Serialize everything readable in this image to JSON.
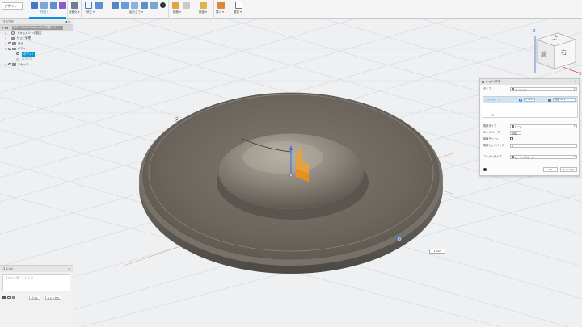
{
  "toolbar": {
    "workspace": "デザイン ▾",
    "groups": [
      {
        "label": "作成 ▾",
        "active": true
      },
      {
        "label": "自動化 ▾"
      },
      {
        "label": "修正 ▾"
      },
      {
        "label": "組み立て ▾"
      },
      {
        "label": "構築 ▾"
      },
      {
        "label": "検査 ▾"
      },
      {
        "label": "挿入 ▾"
      },
      {
        "label": "選択 ▾"
      }
    ]
  },
  "browser": {
    "title": "ブラウザ",
    "items": [
      {
        "label": "SMP・Model Preparation(作業) v1",
        "root": true
      },
      {
        "label": "ドキュメントの設定"
      },
      {
        "label": "ビュー管理"
      },
      {
        "label": "原点"
      },
      {
        "label": "ボディ"
      },
      {
        "label": "ボディ1",
        "selected": true
      },
      {
        "label": "ボディ2"
      },
      {
        "label": "スケッチ"
      }
    ]
  },
  "comments": {
    "title": "コメント",
    "placeholder": "コメントをここに入力",
    "post_label": "ポスト",
    "cancel_label": "キャンセル"
  },
  "viewcube": {
    "top": "上",
    "front": "前",
    "right": "右",
    "axis_x": "X",
    "axis_z": "Z"
  },
  "dialog": {
    "title": "シェル/厚み",
    "type_label": "タイプ",
    "type_value": "フィレット",
    "edges_label": "エッジ/ループ",
    "edge_value": "1 mm",
    "edge_tag": "角度 30 ▾",
    "corner_type_label": "角部タイプ",
    "corner_type_value": "ロール",
    "tangent_chain_label": "エッジ/ループ",
    "tangent_chain_value": "反転",
    "g2_label": "接線チェーン",
    "setback_label": "角部セットバック",
    "setback_value": "0",
    "corner_style_label": "コーナータイプ",
    "corner_style_value": "ローリングボール",
    "ok_label": "OK",
    "cancel_label": "キャンセル"
  },
  "canvas": {
    "distance": "1 mm"
  },
  "colors": {
    "accent": "#0696d7",
    "model": "#6a645c",
    "grid": "#c9cdd2",
    "gizmo": "#f2a12c"
  }
}
